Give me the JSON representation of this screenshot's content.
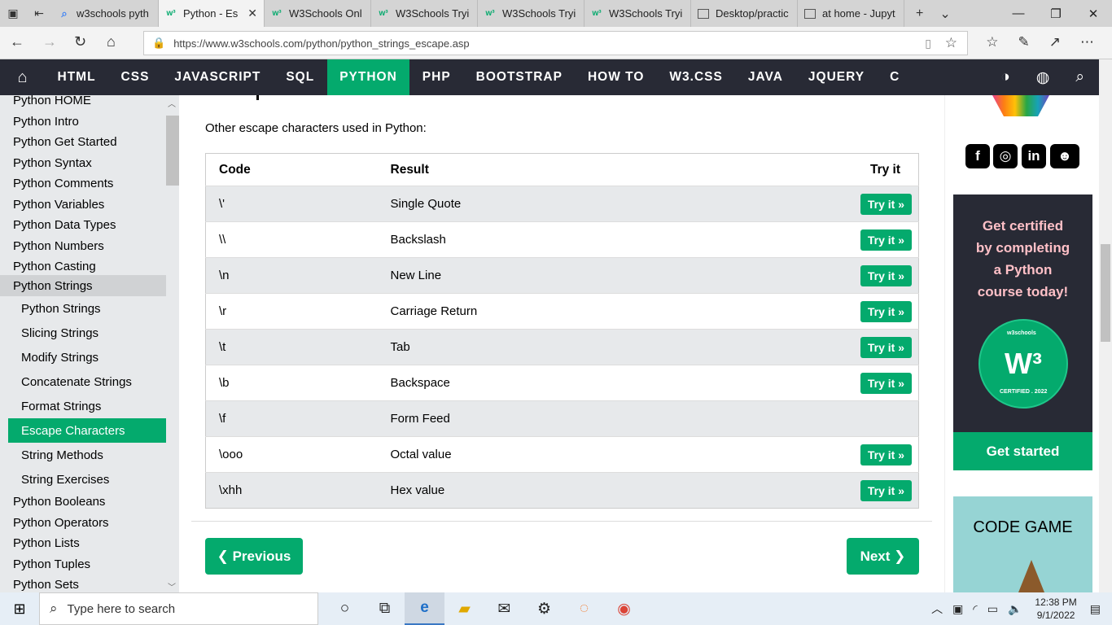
{
  "browser": {
    "tabs": [
      {
        "label": "w3schools pyth",
        "favicon": "google-icon"
      },
      {
        "label": "Python - Es",
        "favicon": "w3-icon",
        "active": true
      },
      {
        "label": "W3Schools Onl",
        "favicon": "w3-icon"
      },
      {
        "label": "W3Schools Tryi",
        "favicon": "w3-icon"
      },
      {
        "label": "W3Schools Tryi",
        "favicon": "w3-icon"
      },
      {
        "label": "W3Schools Tryi",
        "favicon": "w3-icon"
      },
      {
        "label": "Desktop/practic",
        "favicon": "file-icon"
      },
      {
        "label": "at home - Jupyt",
        "favicon": "file-icon"
      }
    ],
    "url": "https://www.w3schools.com/python/python_strings_escape.asp"
  },
  "topnav": {
    "items": [
      "HTML",
      "CSS",
      "JAVASCRIPT",
      "SQL",
      "PYTHON",
      "PHP",
      "BOOTSTRAP",
      "HOW TO",
      "W3.CSS",
      "JAVA",
      "JQUERY",
      "C"
    ],
    "active": "PYTHON"
  },
  "sidebar": {
    "top": [
      "Python HOME",
      "Python Intro",
      "Python Get Started",
      "Python Syntax",
      "Python Comments",
      "Python Variables",
      "Python Data Types",
      "Python Numbers",
      "Python Casting"
    ],
    "section": "Python Strings",
    "sub": [
      "Python Strings",
      "Slicing Strings",
      "Modify Strings",
      "Concatenate Strings",
      "Format Strings",
      "Escape Characters",
      "String Methods",
      "String Exercises"
    ],
    "active_sub": "Escape Characters",
    "bottom": [
      "Python Booleans",
      "Python Operators",
      "Python Lists",
      "Python Tuples",
      "Python Sets"
    ]
  },
  "main": {
    "intro": "Other escape characters used in Python:",
    "table": {
      "headers": [
        "Code",
        "Result",
        "Try it"
      ],
      "rows": [
        {
          "code": "\\'",
          "result": "Single Quote",
          "try": "Try it »"
        },
        {
          "code": "\\\\",
          "result": "Backslash",
          "try": "Try it »"
        },
        {
          "code": "\\n",
          "result": "New Line",
          "try": "Try it »"
        },
        {
          "code": "\\r",
          "result": "Carriage Return",
          "try": "Try it »"
        },
        {
          "code": "\\t",
          "result": "Tab",
          "try": "Try it »"
        },
        {
          "code": "\\b",
          "result": "Backspace",
          "try": "Try it »"
        },
        {
          "code": "\\f",
          "result": "Form Feed",
          "try": ""
        },
        {
          "code": "\\ooo",
          "result": "Octal value",
          "try": "Try it »"
        },
        {
          "code": "\\xhh",
          "result": "Hex value",
          "try": "Try it »"
        }
      ]
    },
    "prev": "❮ Previous",
    "next": "Next ❯"
  },
  "right": {
    "social": [
      "facebook-icon",
      "instagram-icon",
      "linkedin-icon",
      "discord-icon"
    ],
    "cert_lines": [
      "Get certified",
      "by completing",
      "a Python",
      "course today!"
    ],
    "badge_top": "w3schools",
    "badge_bottom": "CERTIFIED . 2022",
    "cert_button": "Get started",
    "game_title": "CODE GAME"
  },
  "taskbar": {
    "search_placeholder": "Type here to search",
    "time": "12:38 PM",
    "date": "9/1/2022"
  },
  "colors": {
    "accent": "#04aa6d",
    "nav_bg": "#282a35",
    "sidebar_bg": "#e7e9eb"
  }
}
